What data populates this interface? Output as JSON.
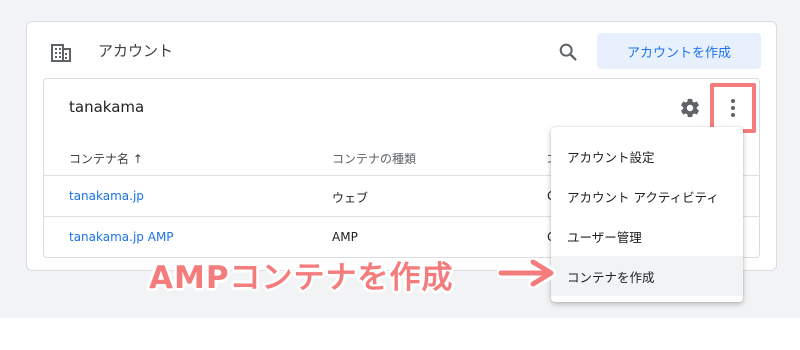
{
  "header": {
    "account_icon": "building-icon",
    "title": "アカウント",
    "search_icon": "search-icon",
    "create_account_label": "アカウントを作成"
  },
  "account": {
    "name": "tanakama",
    "settings_icon": "gear-icon",
    "more_icon": "more-vert-icon"
  },
  "table": {
    "columns": [
      "コンテナ名 ↑",
      "コンテナの種類",
      "コ"
    ],
    "rows": [
      {
        "name": "tanakama.jp",
        "type": "ウェブ",
        "id_partial": "G"
      },
      {
        "name": "tanakama.jp AMP",
        "type": "AMP",
        "id_partial": "G"
      }
    ]
  },
  "menu": {
    "items": [
      {
        "label": "アカウント設定"
      },
      {
        "label": "アカウント アクティビティ"
      },
      {
        "label": "ユーザー管理"
      },
      {
        "label": "コンテナを作成",
        "highlighted": true
      }
    ]
  },
  "annotation": {
    "text": "AMPコンテナを作成",
    "color": "#f47c7c"
  },
  "colors": {
    "accent": "#1a73e8",
    "annotation": "#f47c7c"
  }
}
